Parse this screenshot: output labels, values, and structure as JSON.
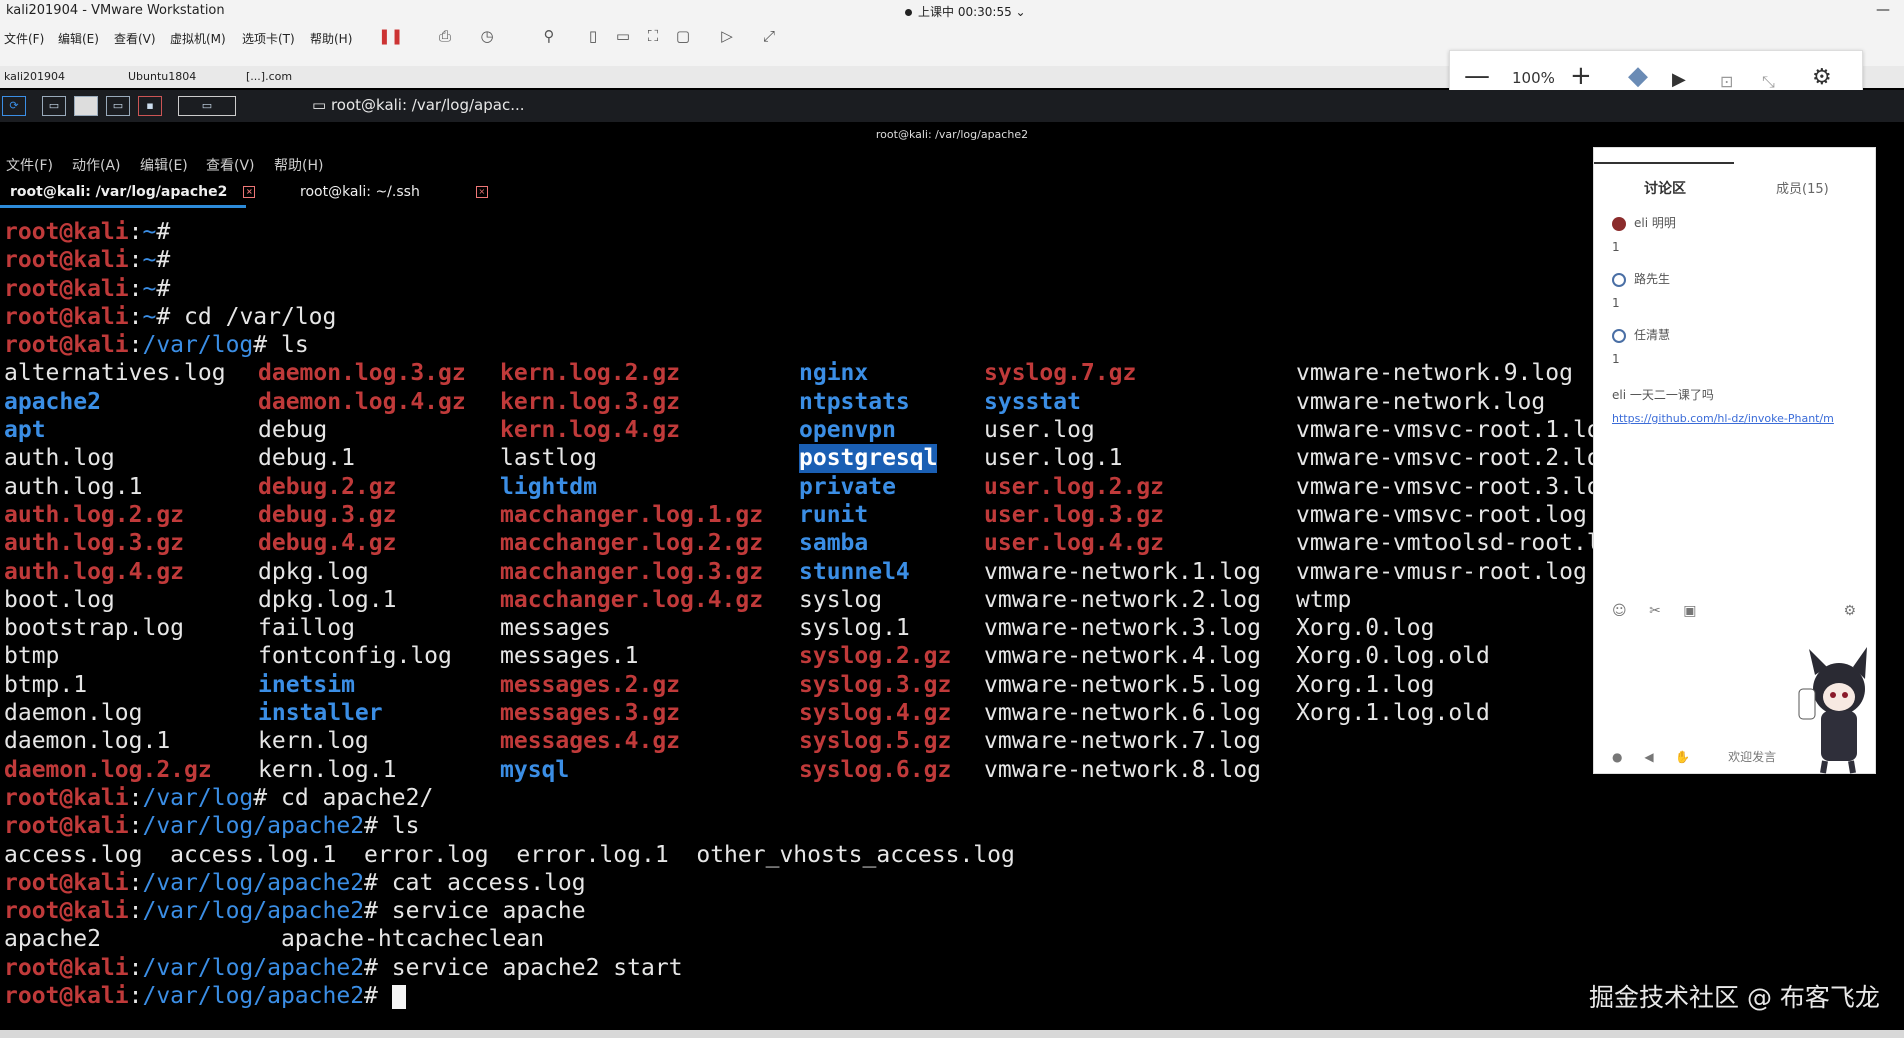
{
  "window": {
    "title": "kali201904 - VMware Workstation",
    "session_status": "上课中 00:30:55"
  },
  "vmware_menu": [
    "文件(F)",
    "编辑(E)",
    "查看(V)",
    "虚拟机(M)",
    "选项卡(T)",
    "帮助(H)"
  ],
  "vm_tabs": [
    "kali201904",
    "Ubuntu1804",
    "[...].com"
  ],
  "zoom": {
    "level": "100%",
    "minus": "—",
    "plus": "+"
  },
  "panel": {
    "task_label": "root@kali: /var/log/apac..."
  },
  "terminal": {
    "window_title": "root@kali: /var/log/apache2",
    "menu": [
      "文件(F)",
      "动作(A)",
      "编辑(E)",
      "查看(V)",
      "帮助(H)"
    ],
    "tabs": [
      "root@kali: /var/log/apache2",
      "root@kali: ~/.ssh"
    ],
    "prompt_user": "root@kali",
    "cmd_lines_top": [
      {
        "path": "~",
        "cmd": ""
      },
      {
        "path": "~",
        "cmd": ""
      },
      {
        "path": "~",
        "cmd": ""
      },
      {
        "path": "~",
        "cmd": " cd /var/log"
      },
      {
        "path": "/var/log",
        "cmd": " ls"
      }
    ],
    "ls_columns": [
      [
        "alternatives.log",
        "apache2",
        "apt",
        "auth.log",
        "auth.log.1",
        "auth.log.2.gz",
        "auth.log.3.gz",
        "auth.log.4.gz",
        "boot.log",
        "bootstrap.log",
        "btmp",
        "btmp.1",
        "daemon.log",
        "daemon.log.1",
        "daemon.log.2.gz"
      ],
      [
        "daemon.log.3.gz",
        "daemon.log.4.gz",
        "debug",
        "debug.1",
        "debug.2.gz",
        "debug.3.gz",
        "debug.4.gz",
        "dpkg.log",
        "dpkg.log.1",
        "faillog",
        "fontconfig.log",
        "inetsim",
        "installer",
        "kern.log",
        "kern.log.1"
      ],
      [
        "kern.log.2.gz",
        "kern.log.3.gz",
        "kern.log.4.gz",
        "lastlog",
        "lightdm",
        "macchanger.log.1.gz",
        "macchanger.log.2.gz",
        "macchanger.log.3.gz",
        "macchanger.log.4.gz",
        "messages",
        "messages.1",
        "messages.2.gz",
        "messages.3.gz",
        "messages.4.gz",
        "mysql"
      ],
      [
        "nginx",
        "ntpstats",
        "openvpn",
        "postgresql",
        "private",
        "runit",
        "samba",
        "stunnel4",
        "syslog",
        "syslog.1",
        "syslog.2.gz",
        "syslog.3.gz",
        "syslog.4.gz",
        "syslog.5.gz",
        "syslog.6.gz"
      ],
      [
        "syslog.7.gz",
        "sysstat",
        "user.log",
        "user.log.1",
        "user.log.2.gz",
        "user.log.3.gz",
        "user.log.4.gz",
        "vmware-network.1.log",
        "vmware-network.2.log",
        "vmware-network.3.log",
        "vmware-network.4.log",
        "vmware-network.5.log",
        "vmware-network.6.log",
        "vmware-network.7.log",
        "vmware-network.8.log"
      ],
      [
        "vmware-network.9.log",
        "vmware-network.log",
        "vmware-vmsvc-root.1.lo",
        "vmware-vmsvc-root.2.lo",
        "vmware-vmsvc-root.3.lo",
        "vmware-vmsvc-root.log",
        "vmware-vmtoolsd-root.l",
        "vmware-vmusr-root.log",
        "wtmp",
        "Xorg.0.log",
        "Xorg.0.log.old",
        "Xorg.1.log",
        "Xorg.1.log.old",
        "",
        ""
      ]
    ],
    "dirs": [
      "apache2",
      "apt",
      "inetsim",
      "installer",
      "lightdm",
      "mysql",
      "nginx",
      "ntpstats",
      "openvpn",
      "postgresql",
      "private",
      "runit",
      "samba",
      "stunnel4",
      "sysstat"
    ],
    "highlighted": "postgresql",
    "cmd_lines_bottom": [
      {
        "path": "/var/log",
        "cmd": " cd apache2/"
      },
      {
        "path": "/var/log/apache2",
        "cmd": " ls"
      }
    ],
    "apache_ls": "access.log  access.log.1  error.log  error.log.1  other_vhosts_access.log",
    "cmd_lines_tail": [
      {
        "path": "/var/log/apache2",
        "cmd": " cat access.log"
      },
      {
        "path": "/var/log/apache2",
        "cmd": " service apache"
      }
    ],
    "service_out": "apache2             apache-htcacheclean",
    "cmd_lines_end": [
      {
        "path": "/var/log/apache2",
        "cmd": " service apache2 start"
      },
      {
        "path": "/var/log/apache2",
        "cmd": " "
      }
    ]
  },
  "chat": {
    "tab_discuss": "讨论区",
    "tab_members": "成员(15)",
    "messages": [
      {
        "name": "eli 明明",
        "text": "1"
      },
      {
        "name": "路先生",
        "text": "1"
      },
      {
        "name": "任清慧",
        "text": "1"
      }
    ],
    "last_msg": "eli 一天二一课了吗",
    "link": "https://github.com/hl-dz/invoke-Phant/m",
    "bottom_text": "欢迎发言"
  },
  "watermark": "掘金技术社区 @ 布客飞龙"
}
